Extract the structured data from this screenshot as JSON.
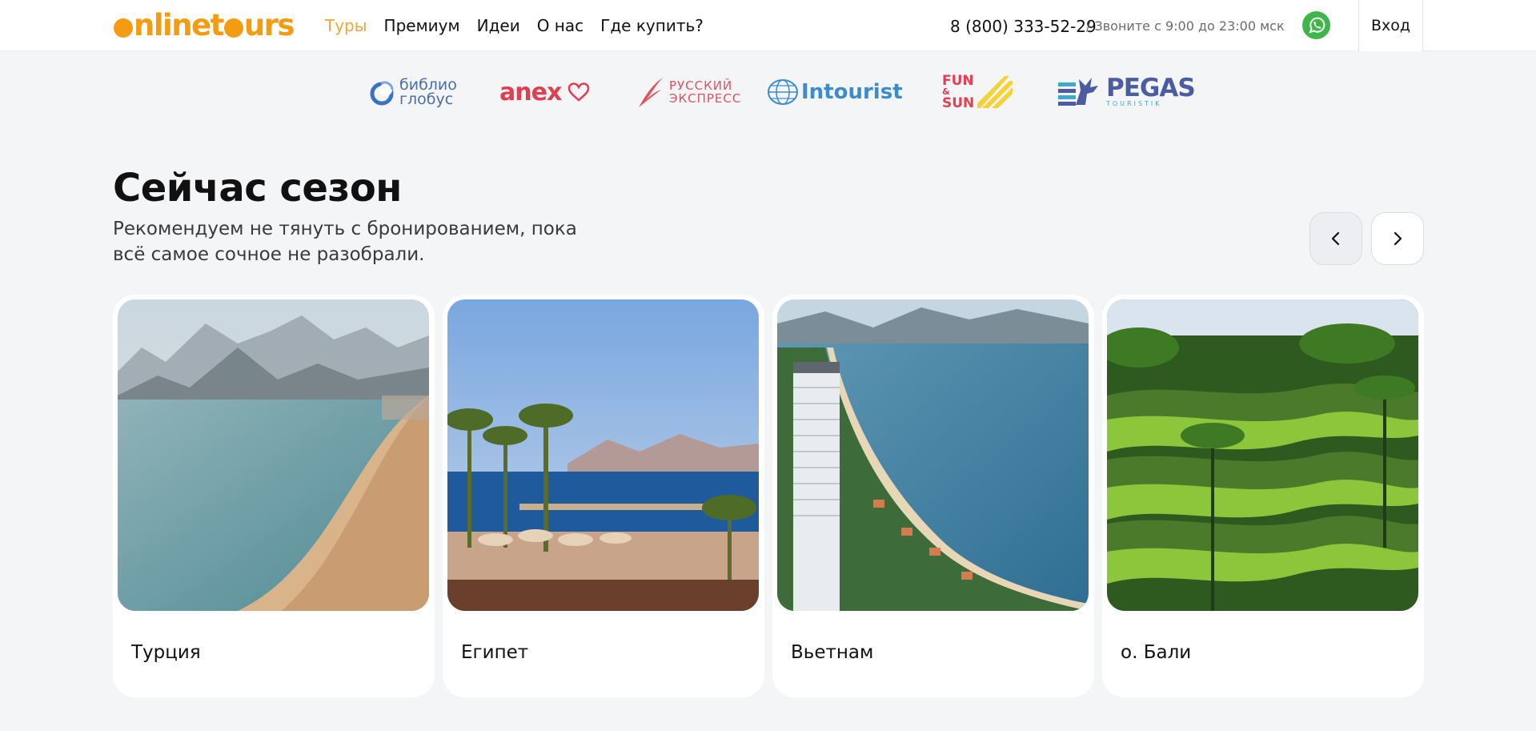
{
  "header": {
    "logo_text": "onlinetours",
    "nav": [
      "Туры",
      "Премиум",
      "Идеи",
      "О нас",
      "Где купить?"
    ],
    "active_nav": "Туры",
    "phone": "8 (800) 333-52-29",
    "hours": "/ Звоните с 9:00 до 23:00 мск",
    "whatsapp_icon": "whatsapp-icon",
    "login_label": "Вход",
    "accent_color": "#e8a93a"
  },
  "partners": {
    "biblio": [
      "библио",
      "глобус"
    ],
    "anex": "anex",
    "russian": [
      "РУССКИЙ",
      "ЭКСПРЕСС"
    ],
    "intourist": "Intourist",
    "funsun": [
      "FUN",
      "&",
      "SUN"
    ],
    "pegas": "PEGAS",
    "pegas_sub": "TOURISTIK"
  },
  "section": {
    "title": "Сейчас сезон",
    "subtitle": "Рекомендуем не тянуть с бронированием, пока всё самое сочное не разобрали."
  },
  "cards": [
    {
      "label": "Турция"
    },
    {
      "label": "Египет"
    },
    {
      "label": "Вьетнам"
    },
    {
      "label": "о. Бали"
    }
  ]
}
